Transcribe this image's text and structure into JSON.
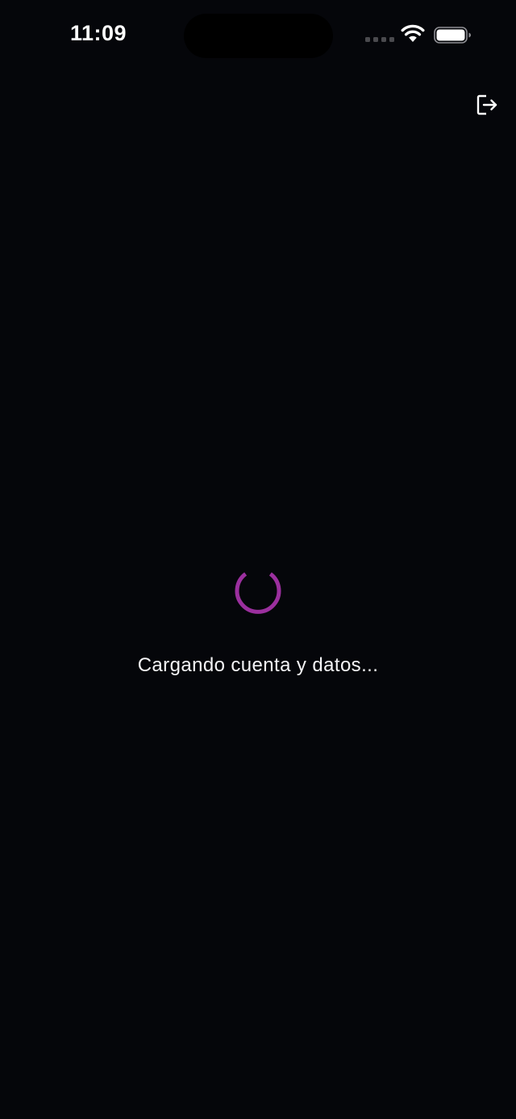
{
  "status_bar": {
    "time": "11:09",
    "icons": [
      "cellular-signal-icon",
      "wifi-icon",
      "battery-icon"
    ]
  },
  "header": {
    "logout_icon": "logout-icon"
  },
  "loader": {
    "message": "Cargando cuenta y datos...",
    "spinner_icon": "loading-spinner-icon"
  },
  "colors": {
    "background": "#05060a",
    "text": "#f4f4f6",
    "accent": "#9b2f9e"
  }
}
